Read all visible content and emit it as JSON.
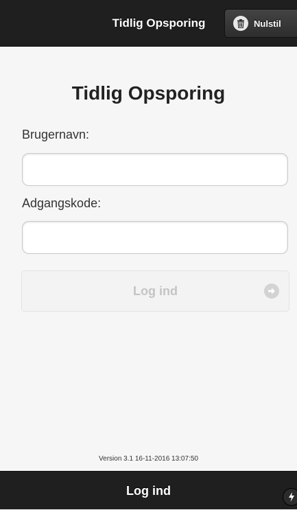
{
  "header": {
    "title": "Tidlig Opsporing",
    "reset_button": {
      "label": "Nulstil",
      "icon": "trash-icon"
    }
  },
  "login": {
    "title": "Tidlig Opsporing",
    "username_label": "Brugernavn:",
    "username_value": "",
    "password_label": "Adgangskode:",
    "password_value": "",
    "submit_label": "Log ind",
    "submit_icon": "arrow-right-circle-icon"
  },
  "version": "Version 3.1 16-11-2016 13:07:50",
  "footer": {
    "title": "Log ind",
    "icon": "lightning-bolt-icon"
  },
  "colors": {
    "bar_background": "#1f1f1f",
    "page_background": "#f6f6f6",
    "disabled_text": "#c4c4c4"
  }
}
